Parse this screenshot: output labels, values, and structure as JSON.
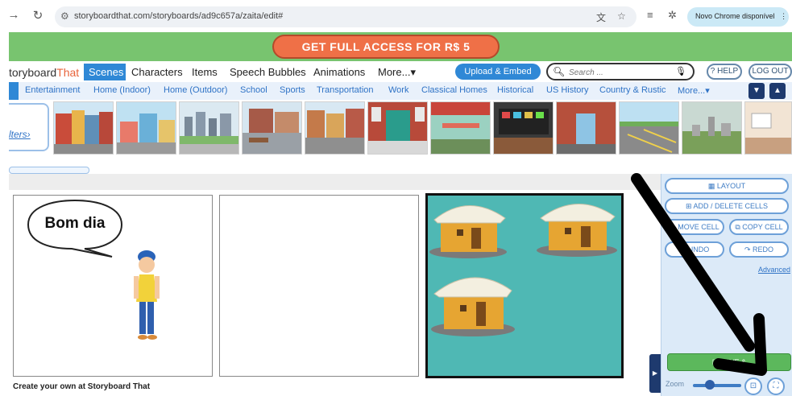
{
  "browser": {
    "url": "storyboardthat.com/storyboards/ad9c657a/zaita/edit#",
    "update_label": "Novo Chrome disponível"
  },
  "promo": {
    "label": "GET FULL ACCESS FOR R$ 5"
  },
  "mainnav": {
    "logo_prefix": "toryboard",
    "logo_suffix": "That",
    "items": [
      "Scenes",
      "Characters",
      "Items",
      "Speech Bubbles",
      "Animations",
      "More..."
    ],
    "more_caret": "▾",
    "upload_label": "Upload & Embed",
    "search_placeholder": "Search ...",
    "help_label": "? HELP",
    "logout_label": "LOG OUT"
  },
  "categories": {
    "items": [
      "Entertainment",
      "Home (Indoor)",
      "Home (Outdoor)",
      "School",
      "Sports",
      "Transportation",
      "Work",
      "Classical Homes",
      "Historical",
      "US History",
      "Country & Rustic",
      "More..."
    ]
  },
  "strip": {
    "filters_label": "lters›"
  },
  "cells": {
    "speech_text": "Bom dia"
  },
  "footer": {
    "text": "Create your own at Storyboard That"
  },
  "side_panel": {
    "layout_label": "LAYOUT",
    "add_delete_label": "ADD / DELETE CELLS",
    "move_cell_label": "MOVE CELL",
    "copy_cell_label": "COPY CELL",
    "undo_label": "UNDO",
    "redo_label": "REDO",
    "advanced_label": "Advanced",
    "save_label": "SAVE &",
    "zoom_label": "Zoom",
    "zoom_level": 0.35
  },
  "colors": {
    "promo_green": "#78c46f",
    "promo_button": "#ef7047",
    "accent_blue": "#2f88d6",
    "hut_wall": "#e6a532",
    "hut_roof": "#f3efe0",
    "cell_bg": "#4fb8b4"
  }
}
